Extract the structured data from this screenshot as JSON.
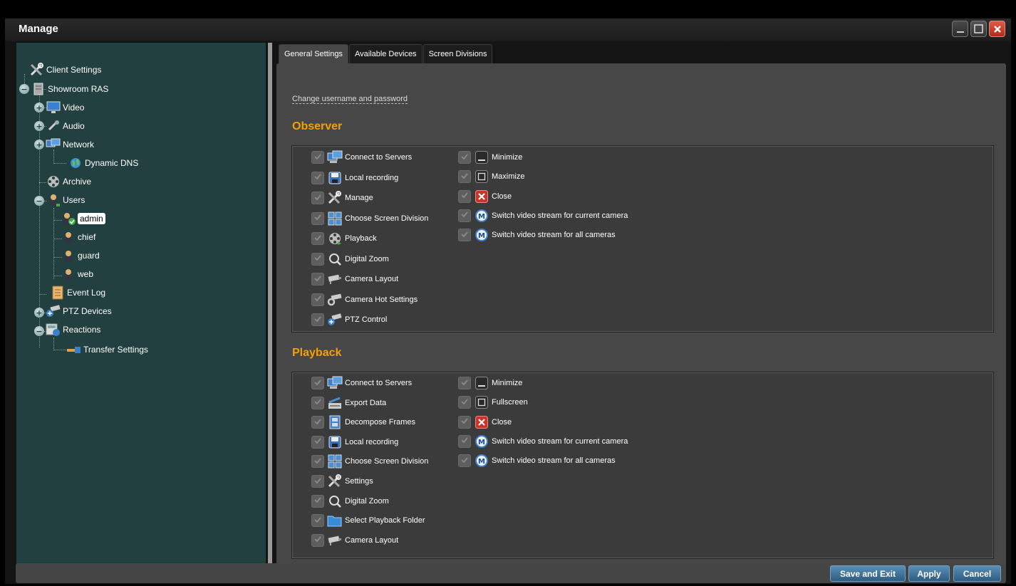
{
  "window": {
    "title": "Manage"
  },
  "tree": [
    {
      "label": "Client Settings",
      "icon": "tools-icon"
    },
    {
      "label": "Showroom RAS",
      "icon": "server-icon"
    },
    {
      "label": "Video",
      "icon": "monitor-icon"
    },
    {
      "label": "Audio",
      "icon": "microphone-icon"
    },
    {
      "label": "Network",
      "icon": "network-icon"
    },
    {
      "label": "Dynamic DNS",
      "icon": "globe-icon"
    },
    {
      "label": "Archive",
      "icon": "film-reel-icon"
    },
    {
      "label": "Users",
      "icon": "users-icon"
    },
    {
      "label": "admin",
      "icon": "admin-user-icon",
      "selected": true
    },
    {
      "label": "chief",
      "icon": "user-icon"
    },
    {
      "label": "guard",
      "icon": "user-icon"
    },
    {
      "label": "web",
      "icon": "user-icon"
    },
    {
      "label": "Event Log",
      "icon": "log-icon"
    },
    {
      "label": "PTZ Devices",
      "icon": "ptz-camera-icon"
    },
    {
      "label": "Reactions",
      "icon": "reactions-icon"
    },
    {
      "label": "Transfer Settings",
      "icon": "transfer-icon"
    }
  ],
  "tabs": [
    "General Settings",
    "Available Devices",
    "Screen Divisions"
  ],
  "change_credentials_link": "Change username and password",
  "observer": {
    "title": "Observer",
    "left": [
      {
        "label": "Connect to Servers",
        "icon": "computers-icon"
      },
      {
        "label": "Local recording",
        "icon": "floppy-disk-icon"
      },
      {
        "label": "Manage",
        "icon": "tools-icon"
      },
      {
        "label": "Choose Screen Division",
        "icon": "grid-icon"
      },
      {
        "label": "Playback",
        "icon": "film-reel-icon"
      },
      {
        "label": "Digital Zoom",
        "icon": "magnifier-icon"
      },
      {
        "label": "Camera Layout",
        "icon": "camera-icon"
      },
      {
        "label": "Camera Hot Settings",
        "icon": "camera-settings-icon"
      },
      {
        "label": "PTZ Control",
        "icon": "ptz-camera-icon"
      }
    ],
    "right": [
      {
        "label": "Minimize",
        "icon": "minimize-icon"
      },
      {
        "label": "Maximize",
        "icon": "maximize-icon"
      },
      {
        "label": "Close",
        "icon": "close-icon"
      },
      {
        "label": "Switch video stream for current camera",
        "icon": "stream-switch-icon"
      },
      {
        "label": "Switch video stream for all cameras",
        "icon": "stream-switch-icon"
      }
    ]
  },
  "playback": {
    "title": "Playback",
    "left": [
      {
        "label": "Connect to Servers",
        "icon": "computers-icon"
      },
      {
        "label": "Export Data",
        "icon": "export-icon"
      },
      {
        "label": "Decompose Frames",
        "icon": "frames-icon"
      },
      {
        "label": "Local recording",
        "icon": "floppy-disk-icon"
      },
      {
        "label": "Choose Screen Division",
        "icon": "grid-icon"
      },
      {
        "label": "Settings",
        "icon": "tools-icon"
      },
      {
        "label": "Digital Zoom",
        "icon": "magnifier-icon"
      },
      {
        "label": "Select Playback Folder",
        "icon": "folder-icon"
      },
      {
        "label": "Camera Layout",
        "icon": "camera-icon"
      }
    ],
    "right": [
      {
        "label": "Minimize",
        "icon": "minimize-icon"
      },
      {
        "label": "Fullscreen",
        "icon": "maximize-icon"
      },
      {
        "label": "Close",
        "icon": "close-icon"
      },
      {
        "label": "Switch video stream for current camera",
        "icon": "stream-switch-icon"
      },
      {
        "label": "Switch video stream for all cameras",
        "icon": "stream-switch-icon"
      }
    ]
  },
  "buttons": {
    "save_exit": "Save and Exit",
    "apply": "Apply",
    "cancel": "Cancel"
  },
  "colors": {
    "section_title": "#f5a000",
    "tree_bg": "#234040",
    "button": "#3d6f96"
  }
}
